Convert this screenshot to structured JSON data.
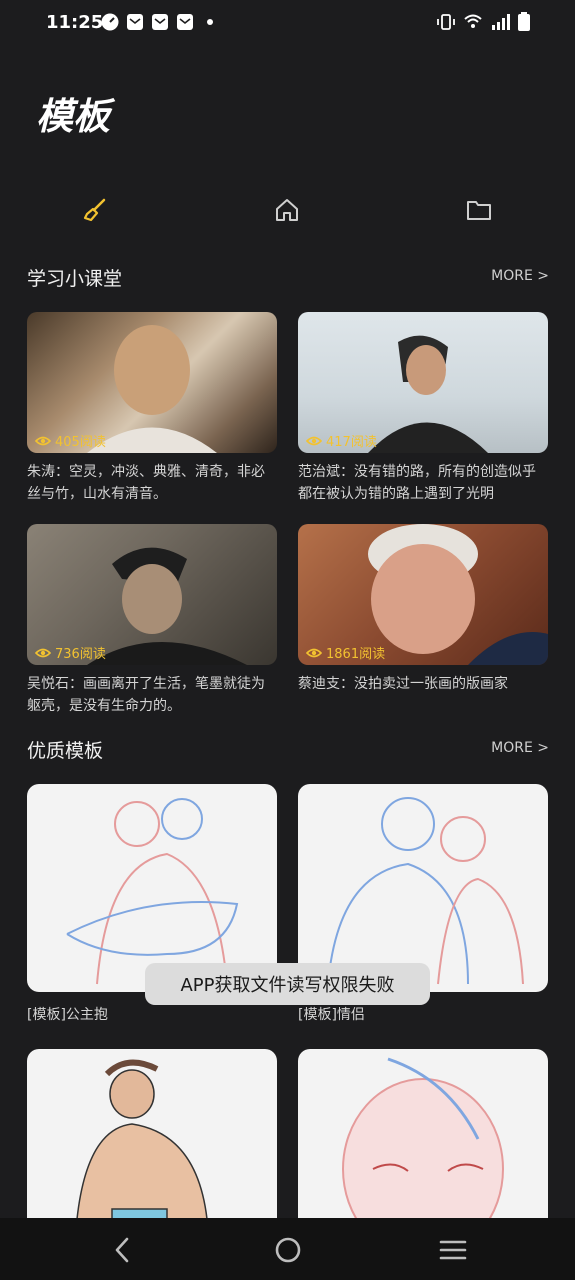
{
  "status": {
    "time": "11:25",
    "left_icons": [
      "speedometer-icon",
      "mail-icon",
      "mail-icon",
      "mail-icon",
      "dot-icon"
    ],
    "right_icons": [
      "vibrate-icon",
      "wifi-icon",
      "signal-icon",
      "battery-icon"
    ]
  },
  "header": {
    "title": "模板"
  },
  "tabs": [
    {
      "icon": "brush-icon",
      "active": true
    },
    {
      "icon": "home-icon",
      "active": false
    },
    {
      "icon": "folder-icon",
      "active": false
    }
  ],
  "colors": {
    "accent": "#f2c230",
    "background": "#1c1c1e"
  },
  "classroom": {
    "title": "学习小课堂",
    "more": "MORE >",
    "cards": [
      {
        "views": "405阅读",
        "caption": "朱涛：空灵，冲淡、典雅、清奇，非必丝与竹，山水有清音。"
      },
      {
        "views": "417阅读",
        "caption": "范治斌：没有错的路，所有的创造似乎都在被认为错的路上遇到了光明"
      },
      {
        "views": "736阅读",
        "caption": "吴悦石：画画离开了生活，笔墨就徒为躯壳，是没有生命力的。"
      },
      {
        "views": "1861阅读",
        "caption": "蔡迪支：没拍卖过一张画的版画家"
      }
    ]
  },
  "templates": {
    "title": "优质模板",
    "more": "MORE >",
    "items": [
      {
        "caption": "[模板]公主抱"
      },
      {
        "caption": "[模板]情侣"
      },
      {
        "caption": ""
      },
      {
        "caption": ""
      }
    ]
  },
  "toast": {
    "text": "APP获取文件读写权限失败"
  },
  "navbar": {
    "buttons": [
      "back-icon",
      "home-circle-icon",
      "menu-icon"
    ]
  }
}
